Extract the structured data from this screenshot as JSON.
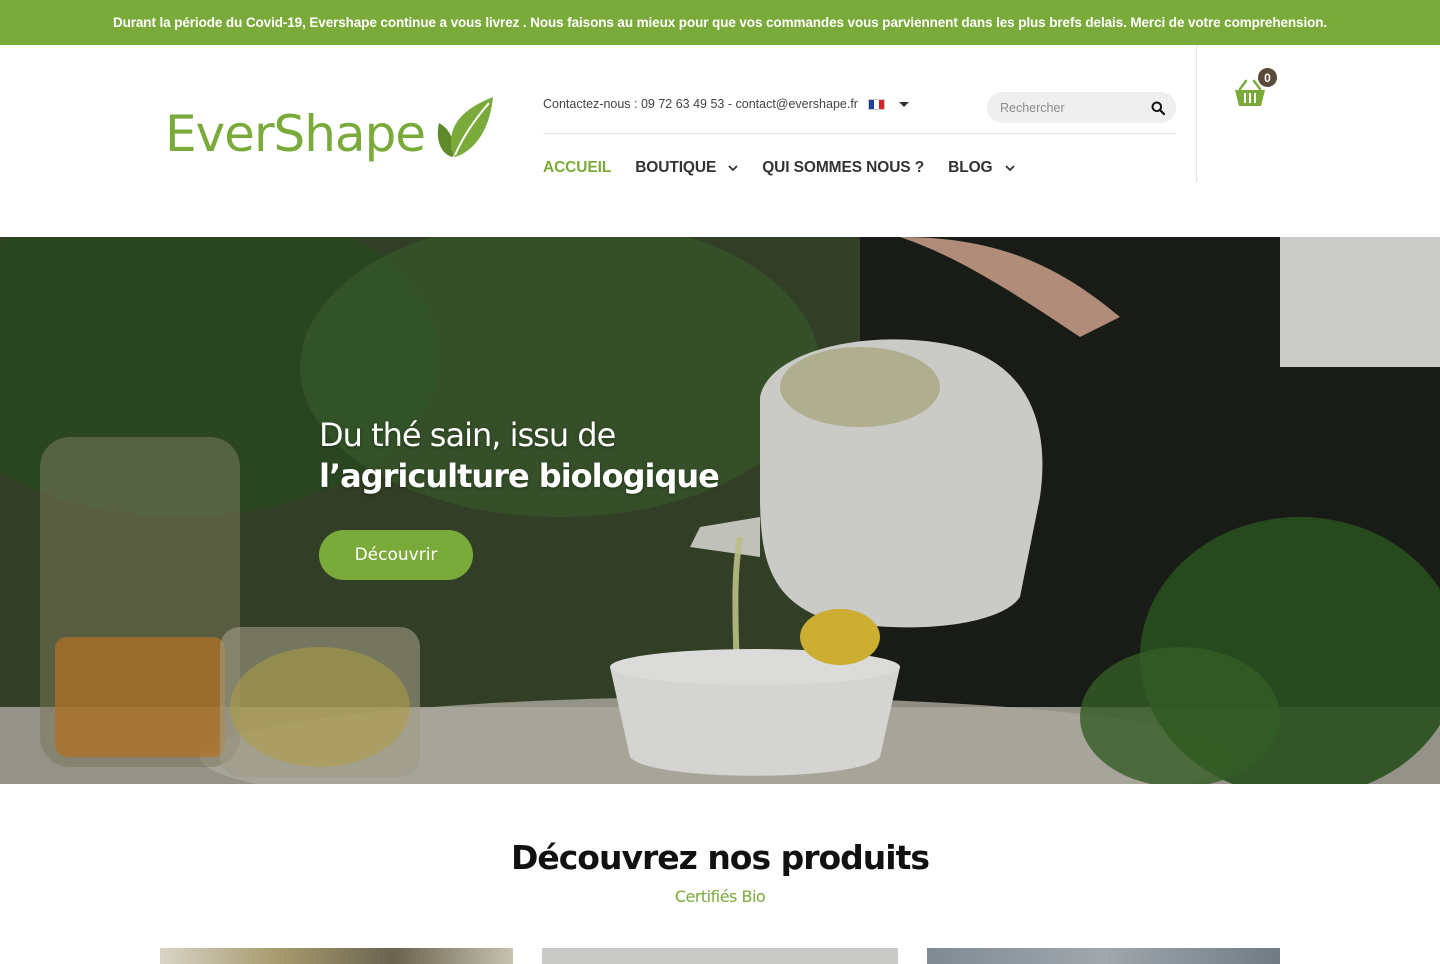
{
  "banner": {
    "text": "Durant la période du Covid-19, Evershape continue a vous livrez . Nous faisons au mieux pour que vos commandes vous parviennent dans les plus brefs delais. Merci de votre comprehension."
  },
  "brand": {
    "name": "EverShape",
    "accent_color": "#7aab3a"
  },
  "contact": {
    "text": "Contactez-nous : 09 72 63 49 53 - contact@evershape.fr",
    "language_flag": "flag-fr-icon"
  },
  "search": {
    "placeholder": "Rechercher",
    "icon": "search-icon"
  },
  "cart": {
    "count": "0",
    "icon": "basket-icon"
  },
  "nav": {
    "items": [
      {
        "label": "ACCUEIL",
        "active": true
      },
      {
        "label": "BOUTIQUE",
        "has_dropdown": true
      },
      {
        "label": "QUI SOMMES NOUS ?"
      },
      {
        "label": "BLOG",
        "has_dropdown": true
      }
    ]
  },
  "hero": {
    "title_line1": "Du thé sain, issu de",
    "title_line2": "l’agriculture biologique",
    "button_label": "Découvrir"
  },
  "products": {
    "title": "Découvrez nos produits",
    "subtitle": "Certifiés Bio"
  }
}
